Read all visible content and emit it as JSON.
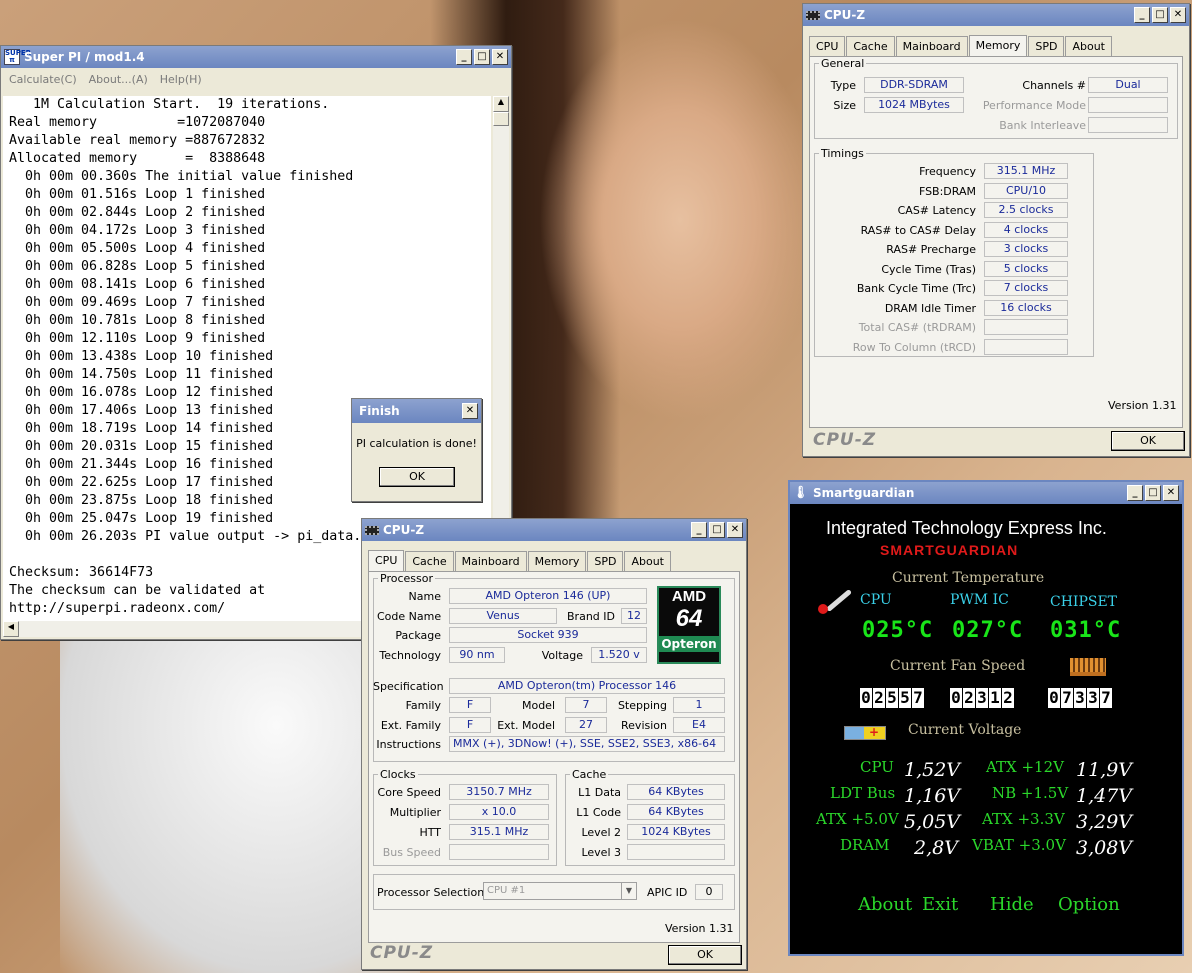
{
  "superpi": {
    "title": "Super PI / mod1.4",
    "menu": [
      "Calculate(C)",
      "About...(A)",
      "Help(H)"
    ],
    "lines": [
      "   1M Calculation Start.  19 iterations.",
      "Real memory          =1072087040",
      "Available real memory =887672832",
      "Allocated memory      =  8388648",
      "  0h 00m 00.360s The initial value finished",
      "  0h 00m 01.516s Loop 1 finished",
      "  0h 00m 02.844s Loop 2 finished",
      "  0h 00m 04.172s Loop 3 finished",
      "  0h 00m 05.500s Loop 4 finished",
      "  0h 00m 06.828s Loop 5 finished",
      "  0h 00m 08.141s Loop 6 finished",
      "  0h 00m 09.469s Loop 7 finished",
      "  0h 00m 10.781s Loop 8 finished",
      "  0h 00m 12.110s Loop 9 finished",
      "  0h 00m 13.438s Loop 10 finished",
      "  0h 00m 14.750s Loop 11 finished",
      "  0h 00m 16.078s Loop 12 finished",
      "  0h 00m 17.406s Loop 13 finished",
      "  0h 00m 18.719s Loop 14 finished",
      "  0h 00m 20.031s Loop 15 finished",
      "  0h 00m 21.344s Loop 16 finished",
      "  0h 00m 22.625s Loop 17 finished",
      "  0h 00m 23.875s Loop 18 finished",
      "  0h 00m 25.047s Loop 19 finished",
      "  0h 00m 26.203s PI value output -> pi_data.txt",
      "",
      "Checksum: 36614F73",
      "The checksum can be validated at",
      "http://superpi.radeonx.com/"
    ]
  },
  "finish": {
    "title": "Finish",
    "message": "PI calculation is done!",
    "ok": "OK"
  },
  "cpuz_mem": {
    "title": "CPU-Z",
    "tabs": [
      "CPU",
      "Cache",
      "Mainboard",
      "Memory",
      "SPD",
      "About"
    ],
    "active_tab": "Memory",
    "general_label": "General",
    "type_label": "Type",
    "type": "DDR-SDRAM",
    "size_label": "Size",
    "size": "1024 MBytes",
    "channels_label": "Channels #",
    "channels": "Dual",
    "perf_label": "Performance Mode",
    "bank_label": "Bank Interleave",
    "timings_label": "Timings",
    "timings": [
      {
        "label": "Frequency",
        "value": "315.1 MHz"
      },
      {
        "label": "FSB:DRAM",
        "value": "CPU/10"
      },
      {
        "label": "CAS# Latency",
        "value": "2.5 clocks"
      },
      {
        "label": "RAS# to CAS# Delay",
        "value": "4 clocks"
      },
      {
        "label": "RAS# Precharge",
        "value": "3 clocks"
      },
      {
        "label": "Cycle Time (Tras)",
        "value": "5 clocks"
      },
      {
        "label": "Bank Cycle Time (Trc)",
        "value": "7 clocks"
      },
      {
        "label": "DRAM Idle Timer",
        "value": "16 clocks"
      },
      {
        "label": "Total CAS# (tRDRAM)",
        "value": ""
      },
      {
        "label": "Row To Column (tRCD)",
        "value": ""
      }
    ],
    "version": "Version 1.31",
    "logo": "CPU-Z",
    "ok": "OK"
  },
  "cpuz_cpu": {
    "title": "CPU-Z",
    "tabs": [
      "CPU",
      "Cache",
      "Mainboard",
      "Memory",
      "SPD",
      "About"
    ],
    "active_tab": "CPU",
    "processor_label": "Processor",
    "name_label": "Name",
    "name": "AMD Opteron 146 (UP)",
    "codename_label": "Code Name",
    "codename": "Venus",
    "brandid_label": "Brand ID",
    "brandid": "12",
    "package_label": "Package",
    "package": "Socket 939",
    "technology_label": "Technology",
    "technology": "90 nm",
    "voltage_label": "Voltage",
    "voltage": "1.520 v",
    "amd_logo": {
      "brand": "AMD",
      "num": "64",
      "product": "Opteron"
    },
    "spec_label": "Specification",
    "spec": "AMD Opteron(tm) Processor 146",
    "family_label": "Family",
    "family": "F",
    "model_label": "Model",
    "model": "7",
    "stepping_label": "Stepping",
    "stepping": "1",
    "extfamily_label": "Ext. Family",
    "extfamily": "F",
    "extmodel_label": "Ext. Model",
    "extmodel": "27",
    "revision_label": "Revision",
    "revision": "E4",
    "instructions_label": "Instructions",
    "instructions": "MMX (+), 3DNow! (+), SSE, SSE2, SSE3, x86-64",
    "clocks_label": "Clocks",
    "corespeed_label": "Core Speed",
    "corespeed": "3150.7 MHz",
    "multiplier_label": "Multiplier",
    "multiplier": "x 10.0",
    "htt_label": "HTT",
    "htt": "315.1 MHz",
    "busspeed_label": "Bus Speed",
    "cache_label": "Cache",
    "l1data_label": "L1 Data",
    "l1data": "64 KBytes",
    "l1code_label": "L1 Code",
    "l1code": "64 KBytes",
    "level2_label": "Level 2",
    "level2": "1024 KBytes",
    "level3_label": "Level 3",
    "procsel_label": "Processor Selection",
    "procsel": "CPU #1",
    "apic_label": "APIC ID",
    "apic": "0",
    "version": "Version 1.31",
    "logo": "CPU-Z",
    "ok": "OK"
  },
  "smartguardian": {
    "title": "Smartguardian",
    "company": "Integrated Technology Express Inc.",
    "product": "SMARTGUARDIAN",
    "temp_heading": "Current Temperature",
    "temp_labels": [
      "CPU",
      "PWM IC",
      "CHIPSET"
    ],
    "temps": [
      "025°C",
      "027°C",
      "031°C"
    ],
    "fan_heading": "Current Fan Speed",
    "fans": [
      "02557",
      "02312",
      "07337"
    ],
    "volt_heading": "Current Voltage",
    "voltages": [
      {
        "label": "CPU",
        "value": "1,52V"
      },
      {
        "label": "ATX +12V",
        "value": "11,9V"
      },
      {
        "label": "LDT Bus",
        "value": "1,16V"
      },
      {
        "label": "NB +1.5V",
        "value": "1,47V"
      },
      {
        "label": "ATX +5.0V",
        "value": "5,05V"
      },
      {
        "label": "ATX +3.3V",
        "value": "3,29V"
      },
      {
        "label": "DRAM",
        "value": "2,8V"
      },
      {
        "label": "VBAT +3.0V",
        "value": "3,08V"
      }
    ],
    "buttons": [
      "About",
      "Exit",
      "Hide",
      "Option"
    ],
    "colors": {
      "green": "#2bd82b",
      "red": "#e01a1a",
      "heading": "#c8c0a0"
    }
  }
}
